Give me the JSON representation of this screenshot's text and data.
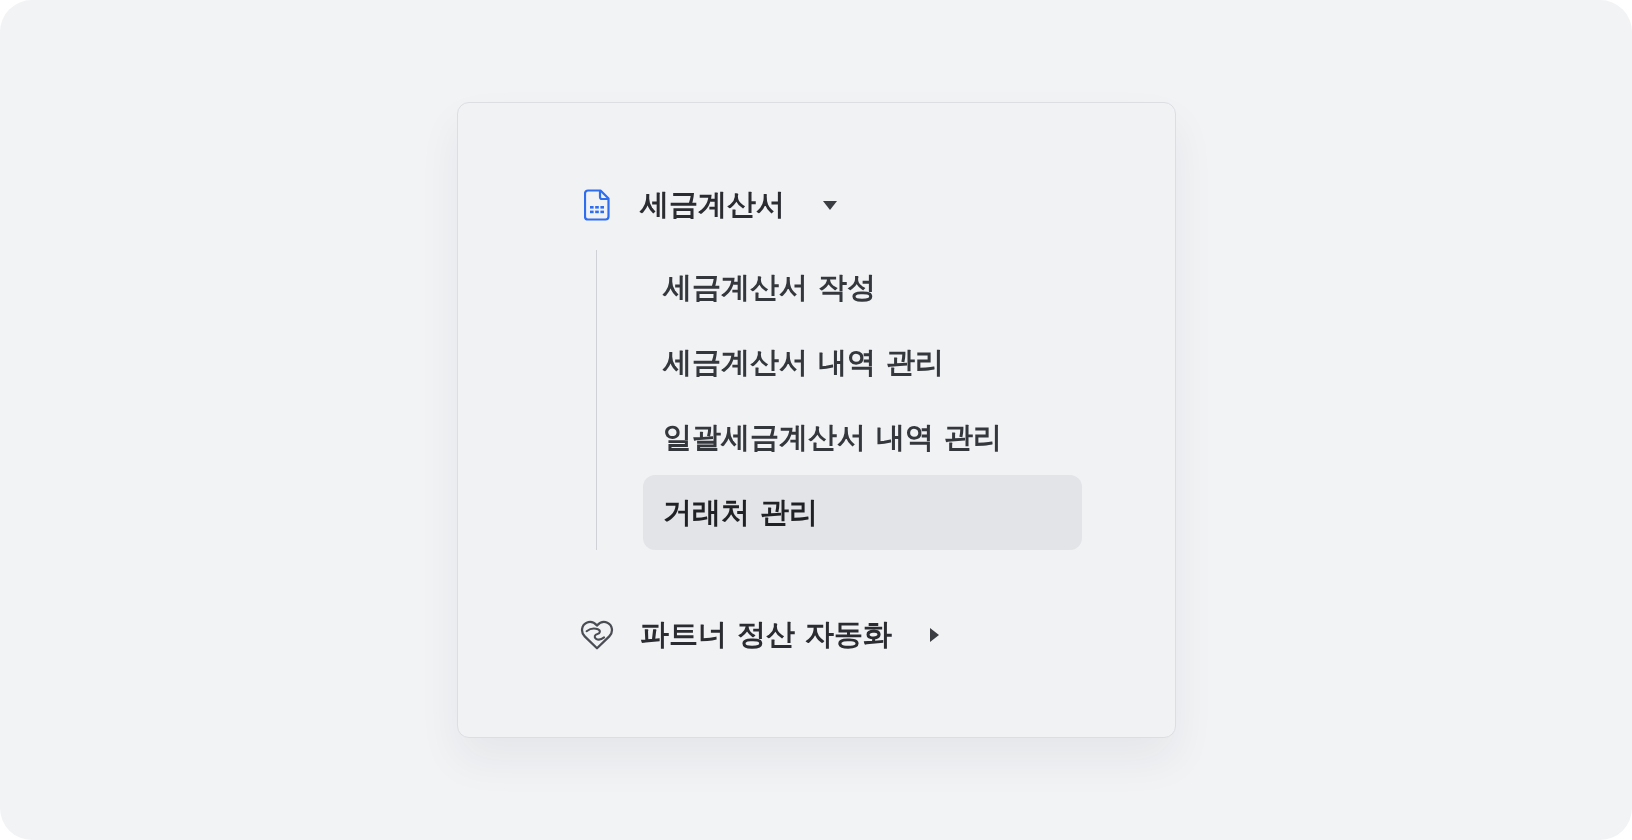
{
  "menu": [
    {
      "kind": "group",
      "label": "세금계산서",
      "expanded": true,
      "children": [
        {
          "label": "세금계산서 작성",
          "selected": false
        },
        {
          "label": "세금계산서 내역 관리",
          "selected": false
        },
        {
          "label": "일괄세금계산서 내역 관리",
          "selected": false
        },
        {
          "label": "거래처 관리",
          "selected": true
        }
      ]
    },
    {
      "kind": "group",
      "label": "파트너 정산 자동화",
      "expanded": false
    }
  ]
}
